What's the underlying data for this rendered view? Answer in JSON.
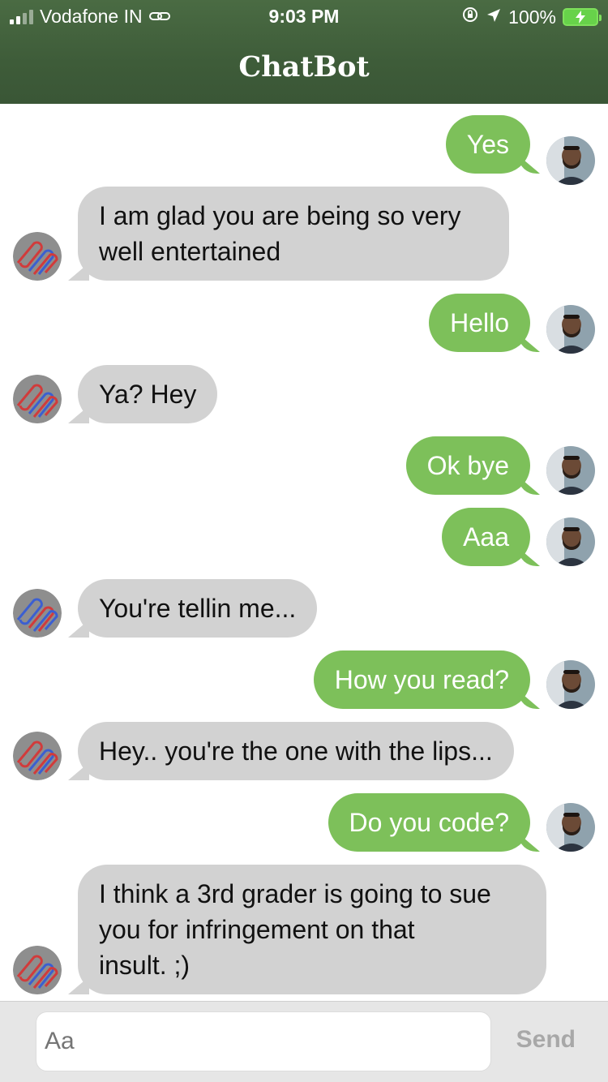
{
  "status_bar": {
    "carrier": "Vodafone IN",
    "time": "9:03 PM",
    "battery": "100%"
  },
  "header": {
    "title": "ChatBot"
  },
  "messages": [
    {
      "sender": "user",
      "text": "Yes"
    },
    {
      "sender": "bot",
      "lines": [
        "I am glad you are being so very",
        "well entertained"
      ]
    },
    {
      "sender": "user",
      "text": "Hello"
    },
    {
      "sender": "bot",
      "text": "Ya? Hey"
    },
    {
      "sender": "user",
      "text": "Ok bye"
    },
    {
      "sender": "user",
      "text": "Aaa"
    },
    {
      "sender": "bot",
      "text": "You're tellin me..."
    },
    {
      "sender": "user",
      "text": "How you read?"
    },
    {
      "sender": "bot",
      "text": "Hey.. you're the one with the lips..."
    },
    {
      "sender": "user",
      "text": "Do you code?"
    },
    {
      "sender": "bot",
      "lines": [
        "I think a 3rd grader is going to sue",
        "you for infringement on that",
        "insult. ;)"
      ]
    }
  ],
  "composer": {
    "placeholder": "Aa",
    "send_label": "Send"
  },
  "colors": {
    "header": "#3e5c39",
    "user_bubble": "#7dc05a",
    "bot_bubble": "#d2d2d2",
    "battery": "#67d24a"
  }
}
